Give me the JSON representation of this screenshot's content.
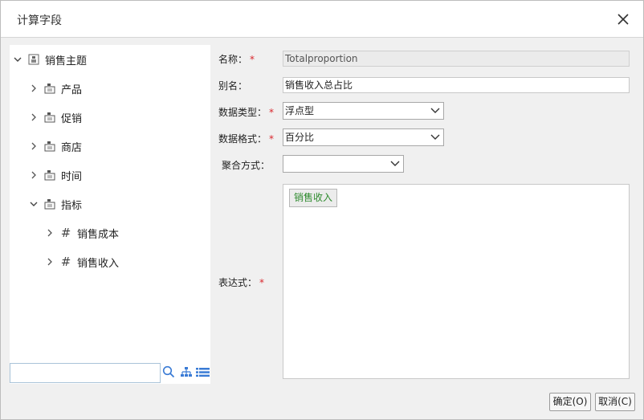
{
  "dialog": {
    "title": "计算字段"
  },
  "tree": {
    "root": {
      "label": "销售主题"
    },
    "nodes": [
      {
        "label": "产品"
      },
      {
        "label": "促销"
      },
      {
        "label": "商店"
      },
      {
        "label": "时间"
      },
      {
        "label": "指标"
      }
    ],
    "measures": [
      {
        "label": "销售成本"
      },
      {
        "label": "销售收入"
      }
    ],
    "search": {
      "value": "",
      "placeholder": ""
    }
  },
  "form": {
    "name_label": "名称：",
    "name_value": "Totalproportion",
    "alias_label": "别名：",
    "alias_value": "销售收入总占比",
    "datatype_label": "数据类型：",
    "datatype_value": "浮点型",
    "format_label": "数据格式：",
    "format_value": "百分比",
    "agg_label": "聚合方式：",
    "agg_value": "",
    "expr_label": "表达式：",
    "expr_token": "销售收入",
    "required_mark": "*"
  },
  "buttons": {
    "ok": "确定(O)",
    "cancel": "取消(C)"
  }
}
